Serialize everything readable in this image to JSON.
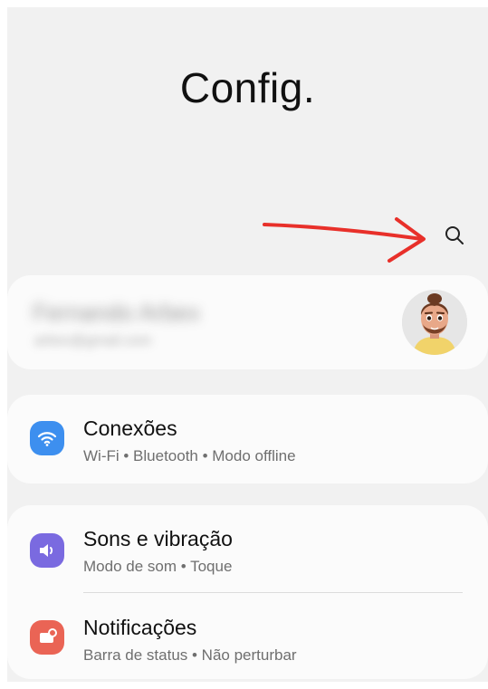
{
  "header": {
    "title": "Config."
  },
  "search": {
    "icon": "search-icon"
  },
  "annotation": {
    "icon": "red-arrow-icon",
    "color": "#e8302a"
  },
  "account": {
    "name": "Fernando Arbex",
    "email": "arbex@gmail.com",
    "avatar": "memoji-avatar"
  },
  "settings": [
    {
      "title": "Conexões",
      "subtitle": "Wi-Fi  •  Bluetooth  •  Modo offline",
      "icon": "wifi-icon",
      "color": "#3d8fef"
    },
    {
      "title": "Sons e vibração",
      "subtitle": "Modo de som  •  Toque",
      "icon": "sound-icon",
      "color": "#7a6ae0"
    },
    {
      "title": "Notificações",
      "subtitle": "Barra de status  •  Não perturbar",
      "icon": "notification-icon",
      "color": "#ea6455"
    }
  ]
}
